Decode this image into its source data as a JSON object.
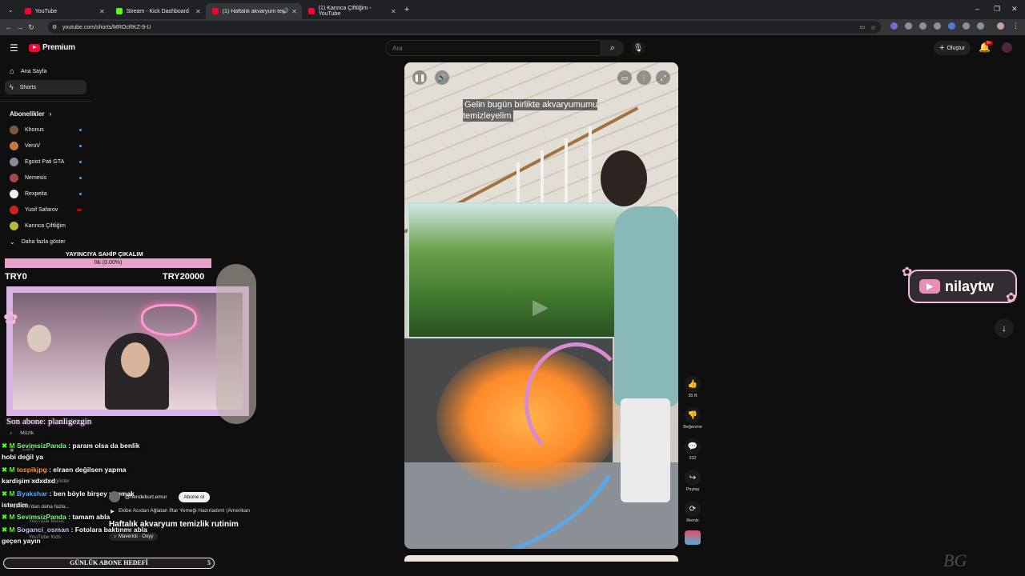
{
  "browser": {
    "tabs": [
      {
        "title": "YouTube",
        "color": "#ff0033"
      },
      {
        "title": "Stream - Kick Dashboard",
        "color": "#53fc18"
      },
      {
        "title": "(1) Haftalık akvaryum temiz...",
        "color": "#ff0033"
      },
      {
        "title": "(1) Karınca Çiftliğim - YouTube",
        "color": "#ff0033"
      }
    ],
    "url": "youtube.com/shorts/MROcRKZ-9-U"
  },
  "yt": {
    "brand": "Premium",
    "search_placeholder": "Ara",
    "create_label": "Oluştur",
    "notif_count": "9+"
  },
  "sidebar": {
    "main": [
      {
        "label": "Ana Sayfa",
        "icon": "home-icon"
      },
      {
        "label": "Shorts",
        "icon": "shorts-icon"
      }
    ],
    "subs_header": "Abonelikler",
    "subs": [
      {
        "label": "Khonus",
        "color": "#7a5a3a"
      },
      {
        "label": "VeroV",
        "color": "#c67a3a"
      },
      {
        "label": "Egoist Pati GTA",
        "color": "#8a8a9a"
      },
      {
        "label": "Nemesis",
        "color": "#a04a4a"
      },
      {
        "label": "Rexpeita",
        "color": "#eeeeee"
      },
      {
        "label": "Yusif Safarov",
        "color": "#cc2222"
      },
      {
        "label": "Karınca Çiftliğim",
        "color": "#b8b83a"
      }
    ],
    "more": "Daha fazla göster",
    "faded": [
      "Müzik",
      "Canlı",
      "Daha fazla göster",
      "YouTube'dan daha fazla...",
      "YouTube Music",
      "YouTube Kids"
    ]
  },
  "overlay": {
    "goal_title": "YAYINCIYA SAHİP ÇIKALIM",
    "goal_value": "0₺ (0.00%)",
    "goal_min": "TRY0",
    "goal_max": "TRY20000",
    "last_sub": "Son abone: planligezgin",
    "chat": [
      {
        "user": "SevimsizPanda",
        "color": "#7fff7f",
        "msg": ": param olsa da benlik"
      },
      {
        "user": "",
        "color": "#ffffff",
        "msg": "hobi değil ya"
      },
      {
        "user": "tospikjpg",
        "color": "#ff9a3c",
        "msg": ": elraen değilsen yapma"
      },
      {
        "user": "",
        "color": "#ffffff",
        "msg": "kardişim xdxdxd"
      },
      {
        "user": "Byakshar",
        "color": "#5ab0ff",
        "msg": ": ben böyle birşey yapmak"
      },
      {
        "user": "",
        "color": "#ffffff",
        "msg": "isterdim"
      },
      {
        "user": "SevimsizPanda",
        "color": "#7fff7f",
        "msg": ": tamam abla"
      },
      {
        "user": "Soganci_osman",
        "color": "#c8c8ff",
        "msg": ": Fotolara baktınmı abla"
      },
      {
        "user": "",
        "color": "#ffffff",
        "msg": "geçen yayın"
      }
    ],
    "daily_goal": "GÜNLÜK ABONE HEDEFİ",
    "daily_count": "5",
    "nilay": "nilaytw"
  },
  "short": {
    "caption": "Gelin bugün birlikte akvaryumumu temizleyelim",
    "channel": "@hendeburt.emur",
    "subscribe": "Abone ol",
    "related": "Ekibe Acıdan Ağlatan İftar Yemeği Hazırladım! (Amerikan",
    "title": "Haftalık akvaryum temizlik rutinim",
    "music": "Maverick · Ooyy",
    "likes": "35 B",
    "dislike_label": "Beğenme",
    "comments": "332",
    "share_label": "Paylaş",
    "remix_label": "Remix"
  }
}
